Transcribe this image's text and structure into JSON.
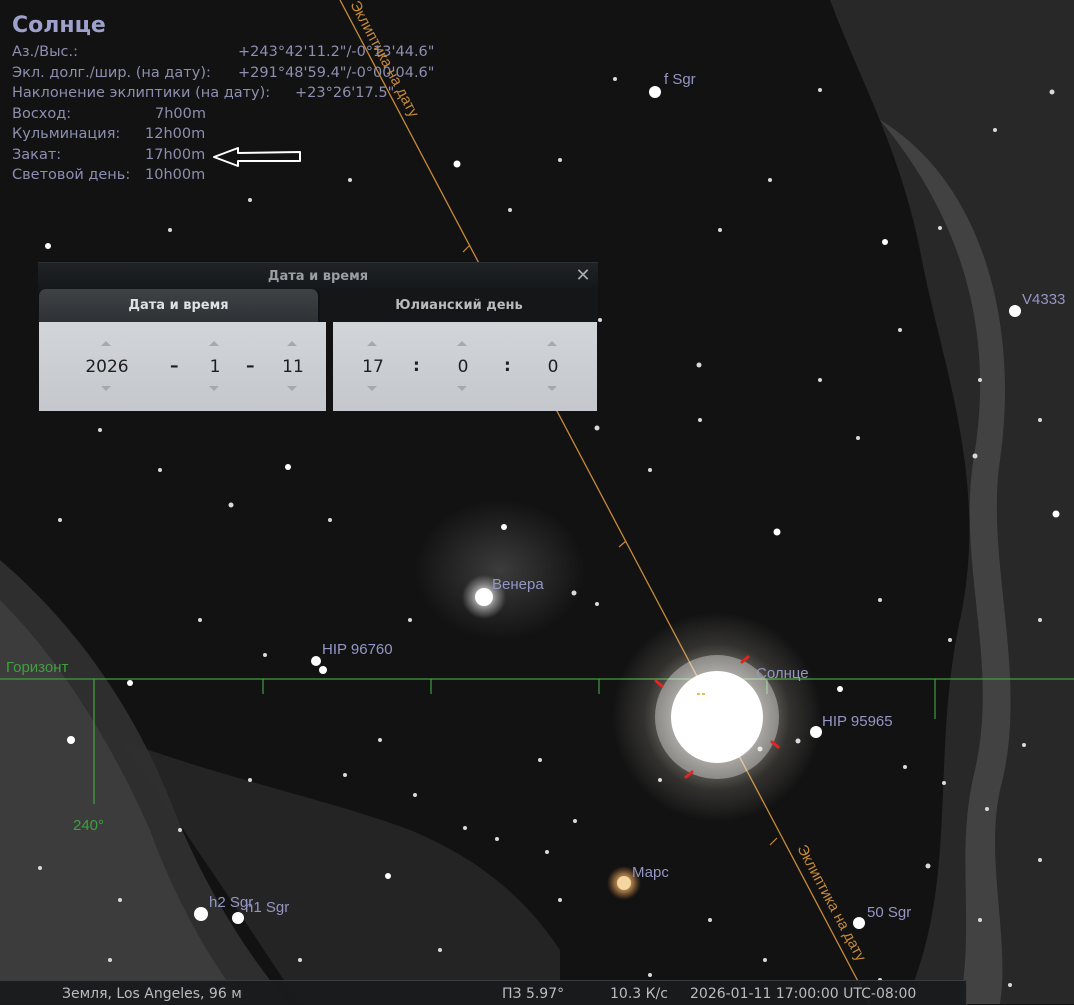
{
  "object_info": {
    "name": "Солнце",
    "rows": [
      {
        "label": "Аз./Выс.:",
        "value": "+243°42'11.2\"/-0°13'44.6\""
      },
      {
        "label": "Экл. долг./шир. (на дату):",
        "value": "+291°48'59.4\"/-0°00'04.6\""
      },
      {
        "label": "Наклонение эклиптики (на дату):",
        "value": "+23°26'17.5\""
      },
      {
        "label": "Восход:",
        "value": "7h00m"
      },
      {
        "label": "Кульминация:",
        "value": "12h00m"
      },
      {
        "label": "Закат:",
        "value": "17h00m"
      },
      {
        "label": "Световой день:",
        "value": "10h00m"
      }
    ]
  },
  "dialog": {
    "title": "Дата и время",
    "close_glyph": "✕",
    "tabs": [
      "Дата и время",
      "Юлианский день"
    ],
    "date": {
      "year": "2026",
      "month": "1",
      "day": "11",
      "separator": "–"
    },
    "time": {
      "hour": "17",
      "minute": "0",
      "second": "0",
      "separator": ":"
    }
  },
  "sky_labels": {
    "ecliptic": "Эклиптика на дату",
    "horizon": "Горизонт",
    "azimuth": "240°",
    "sun": "Солнце",
    "venus": "Венера",
    "mars": "Марс",
    "stars": [
      "f Sgr",
      "V4333",
      "HIP 96760",
      "HIP 95965",
      "h2 Sgr",
      "h1 Sgr",
      "50 Sgr"
    ]
  },
  "status_bar": {
    "location": "Земля, Los Angeles, 96 м",
    "fov": "ПЗ 5.97°",
    "fps": "10.3 К/с",
    "datetime": "2026-01-11 17:00:00 UTC-08:00"
  },
  "colors": {
    "ecliptic": "#c88a3a",
    "horizon": "#3f9f3f",
    "info_text": "#8c8fb0",
    "sky": "#121212"
  }
}
